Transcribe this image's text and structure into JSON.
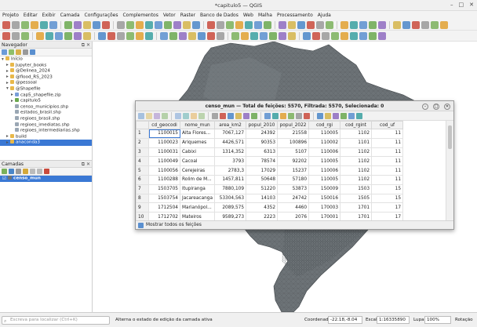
{
  "window": {
    "title": "*capitulo5 — QGIS",
    "min": "–",
    "max": "□",
    "close": "✕"
  },
  "menu": [
    "Projeto",
    "Editar",
    "Exibir",
    "Camada",
    "Configurações",
    "Complementos",
    "Vetor",
    "Raster",
    "Banco de Dados",
    "Web",
    "Malha",
    "Processamento",
    "Ajuda"
  ],
  "navigator": {
    "title": "Navegador",
    "items": [
      {
        "label": "Início",
        "depth": 0,
        "arrow": "▾",
        "icon": "folder"
      },
      {
        "label": "Jupyter_books",
        "depth": 1,
        "arrow": "▸",
        "icon": "folder"
      },
      {
        "label": "@Delinea_2024",
        "depth": 1,
        "arrow": "▸",
        "icon": "folder"
      },
      {
        "label": "@flood_RS_2023",
        "depth": 1,
        "arrow": "▸",
        "icon": "folder"
      },
      {
        "label": "@pessoal",
        "depth": 1,
        "arrow": "▸",
        "icon": "folder"
      },
      {
        "label": "@Shapefile",
        "depth": 1,
        "arrow": "▾",
        "icon": "folder"
      },
      {
        "label": "cap5_shapefile.zip",
        "depth": 2,
        "arrow": "▸",
        "icon": "zip"
      },
      {
        "label": "capitulo5",
        "depth": 2,
        "arrow": "▸",
        "icon": "qgs"
      },
      {
        "label": "censo_municipios.shp",
        "depth": 2,
        "arrow": "",
        "icon": "shp"
      },
      {
        "label": "estados_brasil.shp",
        "depth": 2,
        "arrow": "",
        "icon": "shp"
      },
      {
        "label": "regioes_brasil.shp",
        "depth": 2,
        "arrow": "",
        "icon": "shp"
      },
      {
        "label": "regioes_imediatas.shp",
        "depth": 2,
        "arrow": "",
        "icon": "shp"
      },
      {
        "label": "regioes_intermediarias.shp",
        "depth": 2,
        "arrow": "",
        "icon": "shp"
      },
      {
        "label": "build",
        "depth": 1,
        "arrow": "▸",
        "icon": "folder"
      },
      {
        "label": "anaconda3",
        "depth": 1,
        "arrow": "▸",
        "icon": "folder",
        "selected": true
      }
    ]
  },
  "layers": {
    "title": "Camadas",
    "items": [
      {
        "label": "censo_mun",
        "checked": true,
        "selected": true
      }
    ]
  },
  "attribute_table": {
    "title": "censo_mun — Total de feições: 5570, Filtrada: 5570, Selecionada: 0",
    "columns": [
      "cd_geocodi",
      "nome_mun",
      "area_km2",
      "popul_2010",
      "popul_2022",
      "cod_rgi",
      "cod_rgint",
      "cod_uf"
    ],
    "rows": [
      {
        "n": "1",
        "cells": [
          "1100015",
          "Alta Flores...",
          "7067,127",
          "24392",
          "21558",
          "110005",
          "1102",
          "11"
        ]
      },
      {
        "n": "2",
        "cells": [
          "1100023",
          "Ariquemes",
          "4426,571",
          "90353",
          "100896",
          "110002",
          "1101",
          "11"
        ]
      },
      {
        "n": "3",
        "cells": [
          "1100031",
          "Cabixi",
          "1314,352",
          "6313",
          "5107",
          "110006",
          "1102",
          "11"
        ]
      },
      {
        "n": "4",
        "cells": [
          "1100049",
          "Cacoal",
          "3793",
          "78574",
          "92202",
          "110005",
          "1102",
          "11"
        ]
      },
      {
        "n": "5",
        "cells": [
          "1100056",
          "Cerejeiras",
          "2783,3",
          "17029",
          "15237",
          "110006",
          "1102",
          "11"
        ]
      },
      {
        "n": "6",
        "cells": [
          "1100288",
          "Rolim de M...",
          "1457,811",
          "50648",
          "57180",
          "110005",
          "1102",
          "11"
        ]
      },
      {
        "n": "7",
        "cells": [
          "1503705",
          "Itupiranga",
          "7880,109",
          "51220",
          "53873",
          "150009",
          "1503",
          "15"
        ]
      },
      {
        "n": "8",
        "cells": [
          "1503754",
          "Jacareacanga",
          "53304,563",
          "14103",
          "24742",
          "150016",
          "1505",
          "15"
        ]
      },
      {
        "n": "9",
        "cells": [
          "1712504",
          "Marianópol...",
          "2089,575",
          "4352",
          "4460",
          "170003",
          "1701",
          "17"
        ]
      },
      {
        "n": "10",
        "cells": [
          "1712702",
          "Mateiros",
          "9589,273",
          "2223",
          "2076",
          "170001",
          "1701",
          "17"
        ]
      }
    ],
    "footer_button": "Mostrar todos os feições"
  },
  "status": {
    "search_placeholder": "Escreva para localizar (Ctrl+K)",
    "message": "Alterna o estado de edição da camada ativa",
    "coord_label": "Coordenada",
    "coord_value": "-22.18,-8.04",
    "scale_label": "Escala",
    "scale_value": "1:16335890",
    "lupa_label": "Lupa",
    "lupa_value": "100%",
    "rotation_label": "Rotação"
  }
}
